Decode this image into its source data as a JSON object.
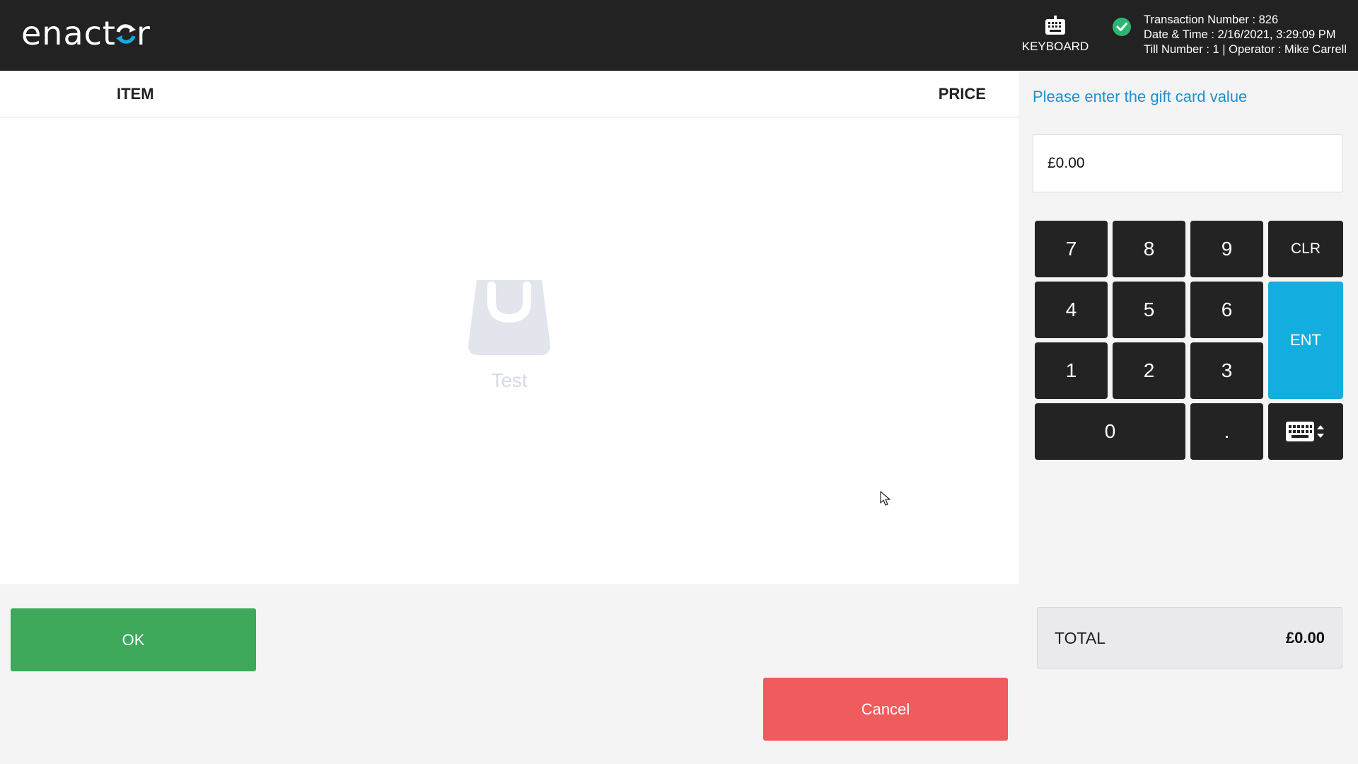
{
  "header": {
    "logo_text": "enactor",
    "keyboard_label": "KEYBOARD",
    "keyboard_icon": "keyboard-icon",
    "status_icon": "check-circle-icon",
    "status_color": "#2bb673",
    "transaction_number": "Transaction Number : 826",
    "date_time": "Date & Time : 2/16/2021, 3:29:09 PM",
    "till_operator": "Till Number : 1 | Operator : Mike Carrell"
  },
  "item_list": {
    "column_item": "ITEM",
    "column_price": "PRICE",
    "empty_icon": "shopping-bag-icon",
    "empty_text": "Test"
  },
  "entry": {
    "prompt": "Please enter the gift card value",
    "value": "£0.00"
  },
  "keypad": {
    "k7": "7",
    "k8": "8",
    "k9": "9",
    "clr": "CLR",
    "k4": "4",
    "k5": "5",
    "k6": "6",
    "ent": "ENT",
    "k1": "1",
    "k2": "2",
    "k3": "3",
    "k0": "0",
    "dot": ".",
    "keyboard_toggle_icon": "keyboard-toggle-icon"
  },
  "total": {
    "label": "TOTAL",
    "value": "£0.00"
  },
  "actions": {
    "ok": "OK",
    "cancel": "Cancel"
  },
  "colors": {
    "header_bg": "#222222",
    "accent_blue": "#13addf",
    "prompt_blue": "#1f8fcf",
    "ok_green": "#3ea95a",
    "cancel_red": "#f05b5e",
    "key_dark": "#232323"
  }
}
